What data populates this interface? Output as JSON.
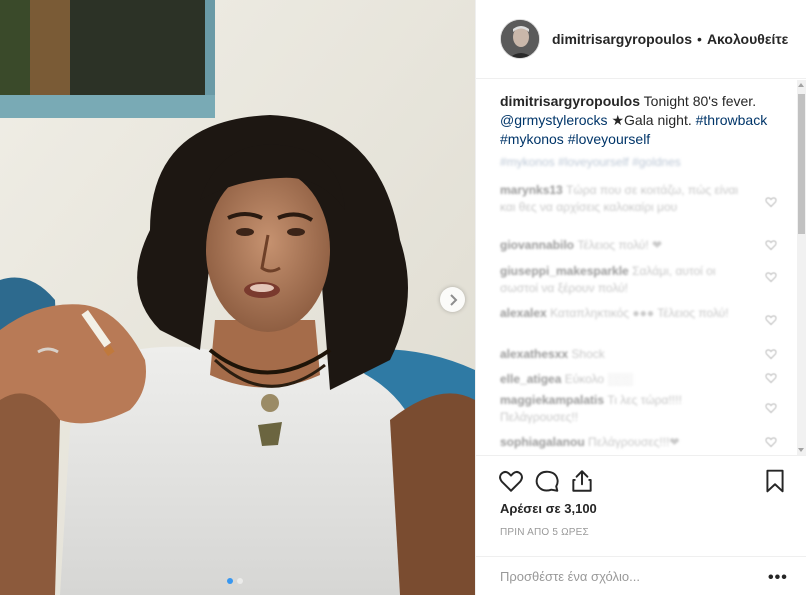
{
  "header": {
    "username": "dimitrisargyropoulos",
    "separator": "•",
    "follow_label": "Ακολουθείτε"
  },
  "caption": {
    "username": "dimitrisargyropoulos",
    "text1": " Tonight 80's fever.",
    "mention": "@grmystylerocks",
    "star": "★",
    "text2": "Gala night. ",
    "tag1": "#throwback",
    "tag2": "#mykonos",
    "tag3": "#loveyourself",
    "blurred_tags": "#mykonos #loveyourself #goldnes"
  },
  "comments": [
    {
      "user": "marynks13",
      "text": "Τώρα που σε κοιτάζω, πώς είναι και θες να αρχίσεις καλοκαίρι μου"
    },
    {
      "user": "giovannabilo",
      "text": "Τέλειος πολύ! ❤"
    },
    {
      "user": "giuseppi_makesparkle",
      "text": "Σαλάμι, αυτοί οι σωστοί να ξέρουν πολύ!"
    },
    {
      "user": "alexalex",
      "text": "Καταπληκτικός ●●● Τέλειος πολύ!"
    },
    {
      "user": "alexathesxx",
      "text": "Shock"
    },
    {
      "user": "elle_atigea",
      "text": "Εύκολο ░░░"
    },
    {
      "user": "maggiekampalatis",
      "text": "Τι λες τώρα!!!! Πελάγρουσες!!"
    },
    {
      "user": "sophiagalanou",
      "text": "Πελάγρουσες!!!❤"
    }
  ],
  "actions": {
    "likes_label": "Αρέσει σε 3,100",
    "time_label": "ΠΡΙΝ ΑΠΟ 5 ΩΡΕΣ"
  },
  "comment_box": {
    "placeholder": "Προσθέστε ένα σχόλιο...",
    "more_label": "•••"
  },
  "carousel": {
    "total_slides": 2,
    "current_slide": 1
  },
  "colors": {
    "link": "#003569",
    "active_dot": "#3897f0"
  }
}
